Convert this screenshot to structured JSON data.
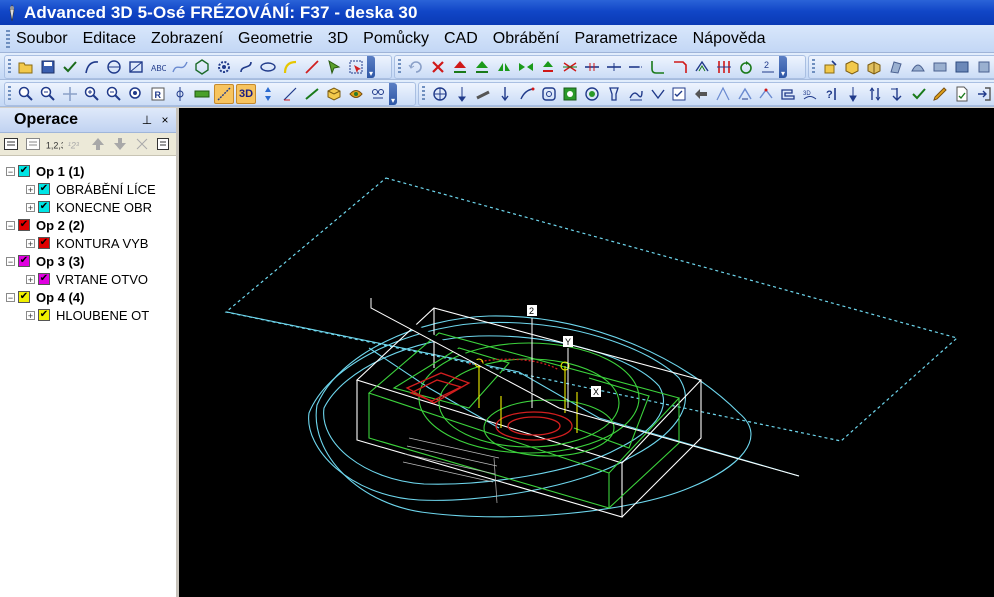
{
  "window": {
    "title": "Advanced 3D 5-Osé FRÉZOVÁNÍ: F37 - deska 30"
  },
  "menu": {
    "items": [
      {
        "label": "Soubor"
      },
      {
        "label": "Editace"
      },
      {
        "label": "Zobrazení"
      },
      {
        "label": "Geometrie"
      },
      {
        "label": "3D"
      },
      {
        "label": "Pomůcky"
      },
      {
        "label": "CAD"
      },
      {
        "label": "Obrábění"
      },
      {
        "label": "Parametrizace"
      },
      {
        "label": "Nápověda"
      }
    ]
  },
  "toolbar": {
    "view_3d_label": "3D"
  },
  "panel": {
    "title": "Operace",
    "pin_icon": "pin-icon",
    "close_label": "×"
  },
  "tree": {
    "op1": {
      "label": "Op 1   (1)",
      "color": "#00e5e5",
      "children": [
        "OBRÁBĚNÍ LÍCE",
        "KONECNE OBR"
      ]
    },
    "op2": {
      "label": "Op 2   (2)",
      "color": "#e00000",
      "children": [
        "KONTURA VYB"
      ]
    },
    "op3": {
      "label": "Op 3   (3)",
      "color": "#e000e0",
      "children": [
        "VRTANE OTVO"
      ]
    },
    "op4": {
      "label": "Op 4   (4)",
      "color": "#f0f000",
      "children": [
        "HLOUBENE OT"
      ]
    }
  },
  "viewport": {
    "axis_labels": {
      "z": "2",
      "y": "Y",
      "x": "X"
    },
    "colors": {
      "background": "#000000",
      "stock": "#ffffff",
      "part": "#3cd23c",
      "toolpath": "#6ed7ee",
      "pocket": "#d21e1e",
      "drill": "#f0f000"
    }
  }
}
